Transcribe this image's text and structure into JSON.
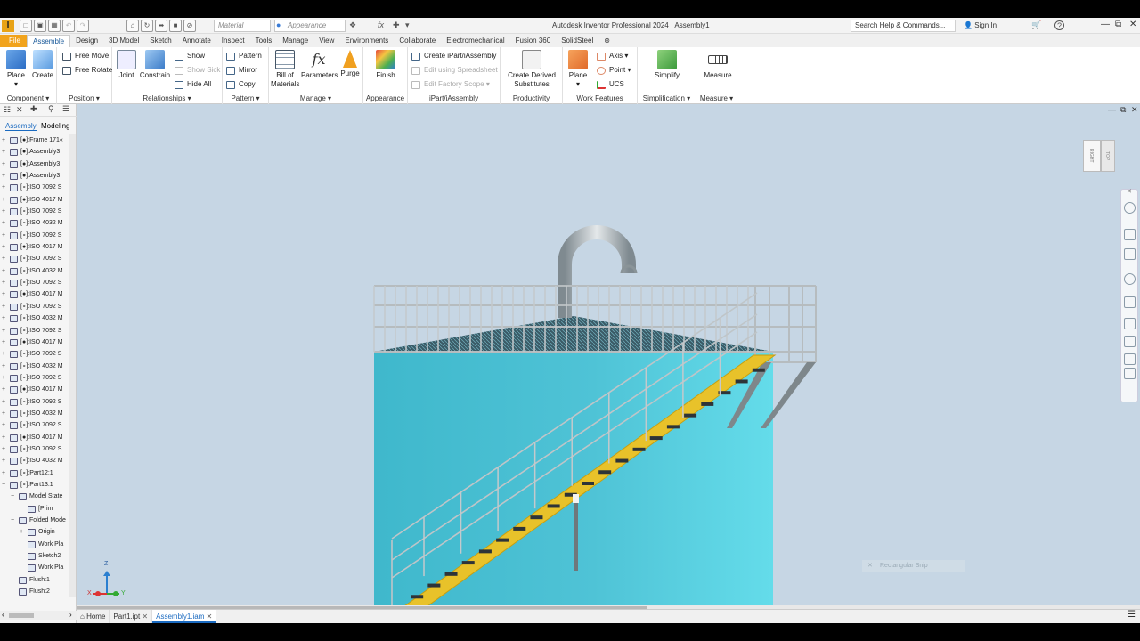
{
  "app": {
    "title": "Autodesk Inventor Professional 2024",
    "document": "Assembly1",
    "logo_letter": "I"
  },
  "titlebar": {
    "material": "Material",
    "appearance": "Appearance",
    "fx_label": "fx",
    "search_placeholder": "Search Help & Commands...",
    "signin": "Sign In",
    "help": "?"
  },
  "ribbon_tabs": [
    "File",
    "Assemble",
    "Design",
    "3D Model",
    "Sketch",
    "Annotate",
    "Inspect",
    "Tools",
    "Manage",
    "View",
    "Environments",
    "Collaborate",
    "Electromechanical",
    "Fusion 360",
    "SolidSteel"
  ],
  "ribbon": {
    "component": {
      "label": "Component",
      "place": "Place",
      "create": "Create"
    },
    "position": {
      "label": "Position",
      "free_move": "Free Move",
      "free_rotate": "Free Rotate"
    },
    "relationships": {
      "label": "Relationships",
      "joint": "Joint",
      "constrain": "Constrain",
      "show": "Show",
      "show_sick": "Show Sick",
      "hide_all": "Hide All"
    },
    "pattern": {
      "label": "Pattern",
      "pattern": "Pattern",
      "mirror": "Mirror",
      "copy": "Copy"
    },
    "manage": {
      "label": "Manage",
      "bom_1": "Bill of",
      "bom_2": "Materials",
      "parameters": "Parameters",
      "purge": "Purge",
      "fx": "fx"
    },
    "appearance": {
      "label": "Appearance",
      "finish": "Finish"
    },
    "ipart": {
      "label": "iPart/iAssembly",
      "create": "Create iPart/iAssembly",
      "edit_spreadsheet": "Edit using Spreadsheet",
      "edit_scope": "Edit Factory Scope"
    },
    "productivity": {
      "label": "Productivity",
      "derived_1": "Create Derived",
      "derived_2": "Substitutes"
    },
    "work_features": {
      "label": "Work Features",
      "plane": "Plane",
      "axis": "Axis",
      "point": "Point",
      "ucs": "UCS"
    },
    "simplification": {
      "label": "Simplification",
      "simplify": "Simplify"
    },
    "measure": {
      "label": "Measure",
      "measure": "Measure"
    }
  },
  "browser": {
    "tabs": [
      "Assembly",
      "Modeling"
    ],
    "items": [
      {
        "text": "[●]:Frame 171«",
        "depth": 0,
        "exp": "+"
      },
      {
        "text": "[●]:Assembly3",
        "depth": 0,
        "exp": "+"
      },
      {
        "text": "[●]:Assembly3",
        "depth": 0,
        "exp": "+"
      },
      {
        "text": "[●]:Assembly3",
        "depth": 0,
        "exp": "+"
      },
      {
        "text": "[∘]:ISO 7092 S",
        "depth": 0,
        "exp": "+"
      },
      {
        "text": "[●]:ISO 4017 M",
        "depth": 0,
        "exp": "+"
      },
      {
        "text": "[∘]:ISO 7092 S",
        "depth": 0,
        "exp": "+"
      },
      {
        "text": "[∘]:ISO 4032 M",
        "depth": 0,
        "exp": "+"
      },
      {
        "text": "[∘]:ISO 7092 S",
        "depth": 0,
        "exp": "+"
      },
      {
        "text": "[●]:ISO 4017 M",
        "depth": 0,
        "exp": "+"
      },
      {
        "text": "[∘]:ISO 7092 S",
        "depth": 0,
        "exp": "+"
      },
      {
        "text": "[∘]:ISO 4032 M",
        "depth": 0,
        "exp": "+"
      },
      {
        "text": "[∘]:ISO 7092 S",
        "depth": 0,
        "exp": "+"
      },
      {
        "text": "[●]:ISO 4017 M",
        "depth": 0,
        "exp": "+"
      },
      {
        "text": "[∘]:ISO 7092 S",
        "depth": 0,
        "exp": "+"
      },
      {
        "text": "[∘]:ISO 4032 M",
        "depth": 0,
        "exp": "+"
      },
      {
        "text": "[∘]:ISO 7092 S",
        "depth": 0,
        "exp": "+"
      },
      {
        "text": "[●]:ISO 4017 M",
        "depth": 0,
        "exp": "+"
      },
      {
        "text": "[∘]:ISO 7092 S",
        "depth": 0,
        "exp": "+"
      },
      {
        "text": "[∘]:ISO 4032 M",
        "depth": 0,
        "exp": "+"
      },
      {
        "text": "[∘]:ISO 7092 S",
        "depth": 0,
        "exp": "+"
      },
      {
        "text": "[●]:ISO 4017 M",
        "depth": 0,
        "exp": "+"
      },
      {
        "text": "[∘]:ISO 7092 S",
        "depth": 0,
        "exp": "+"
      },
      {
        "text": "[∘]:ISO 4032 M",
        "depth": 0,
        "exp": "+"
      },
      {
        "text": "[∘]:ISO 7092 S",
        "depth": 0,
        "exp": "+"
      },
      {
        "text": "[●]:ISO 4017 M",
        "depth": 0,
        "exp": "+"
      },
      {
        "text": "[∘]:ISO 7092 S",
        "depth": 0,
        "exp": "+"
      },
      {
        "text": "[∘]:ISO 4032 M",
        "depth": 0,
        "exp": "+"
      },
      {
        "text": "[∘]:Part12:1",
        "depth": 0,
        "exp": "+"
      },
      {
        "text": "[∘]:Part13:1",
        "depth": 0,
        "exp": "−"
      },
      {
        "text": "Model State",
        "depth": 1,
        "exp": "−"
      },
      {
        "text": "[Prim",
        "depth": 2,
        "exp": ""
      },
      {
        "text": "Folded Mode",
        "depth": 1,
        "exp": "−"
      },
      {
        "text": "Origin",
        "depth": 2,
        "exp": "+"
      },
      {
        "text": "Work Pla",
        "depth": 2,
        "exp": ""
      },
      {
        "text": "Sketch2",
        "depth": 2,
        "exp": ""
      },
      {
        "text": "Work Pla",
        "depth": 2,
        "exp": ""
      },
      {
        "text": "Flush:1",
        "depth": 1,
        "exp": ""
      },
      {
        "text": "Flush:2",
        "depth": 1,
        "exp": ""
      }
    ]
  },
  "viewport": {
    "viewcube_face": "RIGHT",
    "viewcube_back": "TOP",
    "snip_text": "Rectangular Snip",
    "axis_z": "Z",
    "axis_x": "X",
    "axis_y": "Y"
  },
  "doc_tabs": [
    {
      "label": "Home",
      "closable": false
    },
    {
      "label": "Part1.ipt",
      "closable": true
    },
    {
      "label": "Assembly1.iam",
      "closable": true
    }
  ],
  "colors": {
    "tank": "#4fc3d6",
    "stair": "#e8c22a",
    "rail": "#c8c8c8",
    "background": "#c6d6e4",
    "file_tab": "#f1a31c"
  }
}
